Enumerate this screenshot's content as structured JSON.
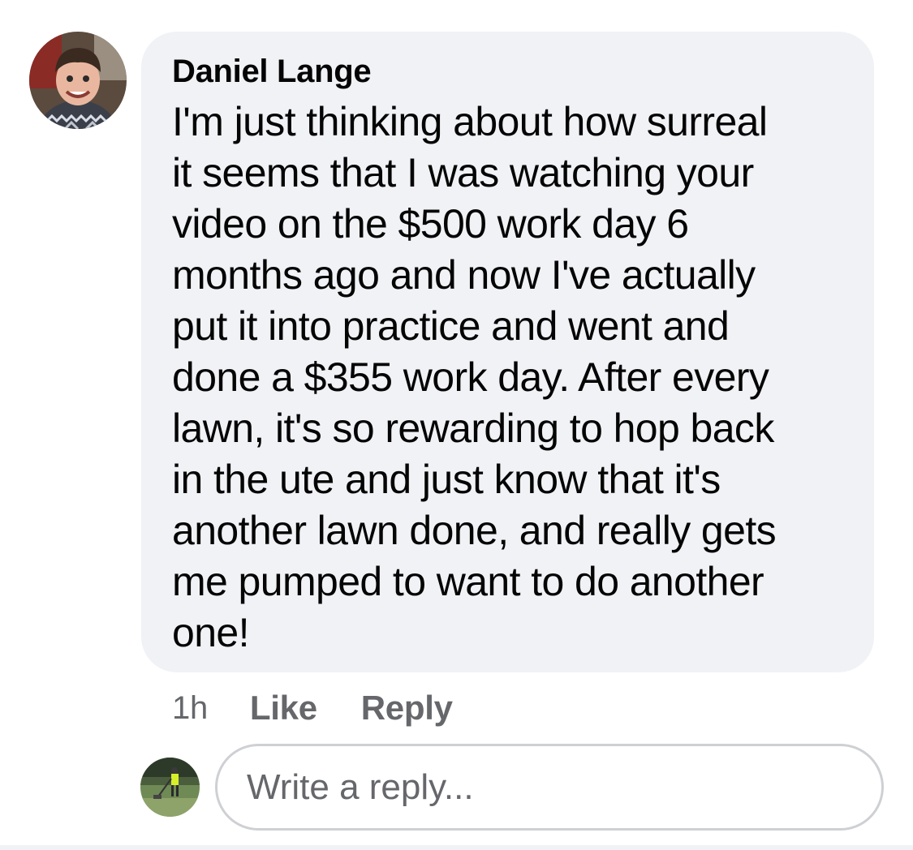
{
  "comment": {
    "author": "Daniel Lange",
    "lines": [
      "I'm just thinking about how surreal",
      "it seems that I was watching your",
      "video on the $500 work day 6",
      "months ago and now I've actually",
      "put it into practice and went and",
      "done a $355 work day. After every",
      "lawn, it's so rewarding to hop back",
      "in the ute and just know that it's",
      "another lawn done, and really gets",
      "me pumped to want to do another",
      "one!"
    ],
    "timestamp": "1h",
    "like_label": "Like",
    "reply_label": "Reply"
  },
  "reply_box": {
    "placeholder": "Write a reply..."
  },
  "colors": {
    "bubble_background": "#f0f2f5",
    "secondary_text": "#65676b",
    "primary_text": "#050505",
    "input_border": "#ced0d4"
  }
}
